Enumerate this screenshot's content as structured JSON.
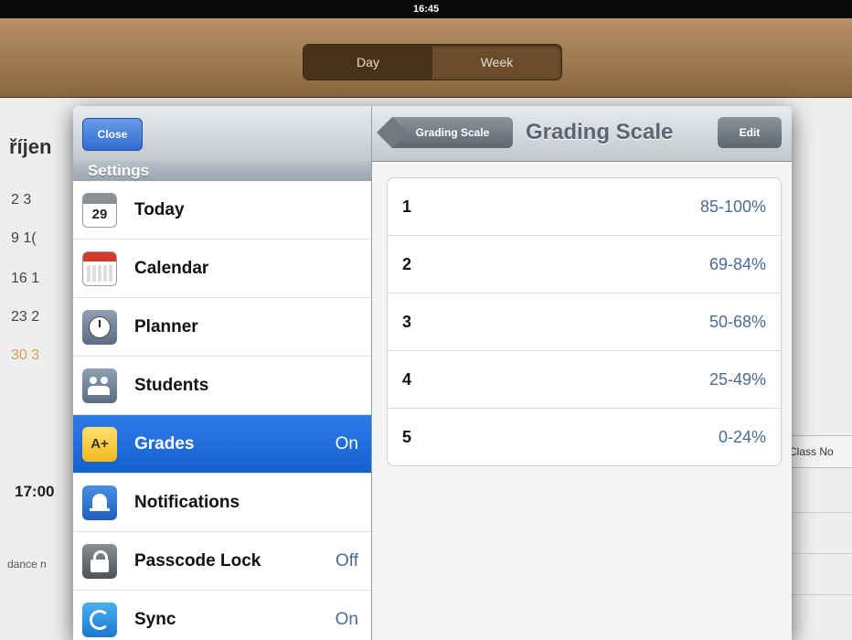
{
  "status_bar": {
    "time": "16:45"
  },
  "toolbar": {
    "segments": [
      "Day",
      "Week"
    ]
  },
  "background": {
    "month": "říjen",
    "rows": [
      "2   3",
      "9   1(",
      "16  1",
      "23  2",
      "30  3"
    ],
    "time": "17:00",
    "attendance": "dance n",
    "class_notes": "Class No"
  },
  "settings": {
    "close_label": "Close",
    "section_title": "Settings",
    "items": [
      {
        "label": "Today",
        "value": "",
        "icon": "today-calendar-icon"
      },
      {
        "label": "Calendar",
        "value": "",
        "icon": "calendar-icon"
      },
      {
        "label": "Planner",
        "value": "",
        "icon": "clock-icon"
      },
      {
        "label": "Students",
        "value": "",
        "icon": "students-icon"
      },
      {
        "label": "Grades",
        "value": "On",
        "icon": "grades-icon"
      },
      {
        "label": "Notifications",
        "value": "",
        "icon": "bell-icon"
      },
      {
        "label": "Passcode Lock",
        "value": "Off",
        "icon": "lock-icon"
      },
      {
        "label": "Sync",
        "value": "On",
        "icon": "sync-icon"
      }
    ],
    "today_icon_day": "29"
  },
  "grading": {
    "back_label": "Grading Scale",
    "title": "Grading Scale",
    "edit_label": "Edit",
    "rows": [
      {
        "grade": "1",
        "range": "85-100%"
      },
      {
        "grade": "2",
        "range": "69-84%"
      },
      {
        "grade": "3",
        "range": "50-68%"
      },
      {
        "grade": "4",
        "range": "25-49%"
      },
      {
        "grade": "5",
        "range": "0-24%"
      }
    ]
  },
  "colors": {
    "selection": "#1f6fe0",
    "value_text": "#4a6a99",
    "toolbar": "#9c7650"
  }
}
